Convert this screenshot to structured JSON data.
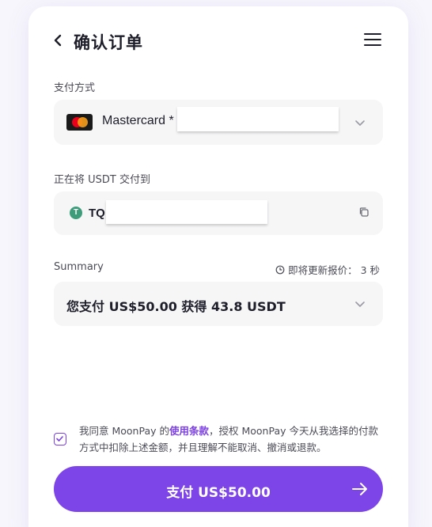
{
  "header": {
    "title": "确认订单"
  },
  "payment_method": {
    "label": "支付方式",
    "card_text": "Mastercard *"
  },
  "delivery": {
    "label": "正在将 USDT 交付到",
    "address_prefix": "TQ"
  },
  "summary": {
    "label": "Summary",
    "refresh_text": "即将更新报价： 3 秒",
    "value": "您支付 US$50.00 获得 43.8 USDT"
  },
  "consent": {
    "text_before": "我同意 MoonPay 的",
    "terms_link": "使用条款",
    "text_after": "，授权 MoonPay 今天从我选择的付款方式中扣除上述金额，并且理解不能取消、撤消或退款。",
    "checked": true
  },
  "pay_button": {
    "label": "支付 US$50.00"
  },
  "colors": {
    "accent": "#7d45e8",
    "field_bg": "#f6f6f7",
    "text": "#1e1e2a",
    "usdt_green": "#3e9c7a"
  },
  "icons": [
    "back-arrow-icon",
    "menu-icon",
    "mastercard-logo",
    "chevron-down-icon",
    "usdt-icon",
    "copy-icon",
    "clock-icon",
    "checkbox-icon",
    "arrow-right-icon"
  ]
}
